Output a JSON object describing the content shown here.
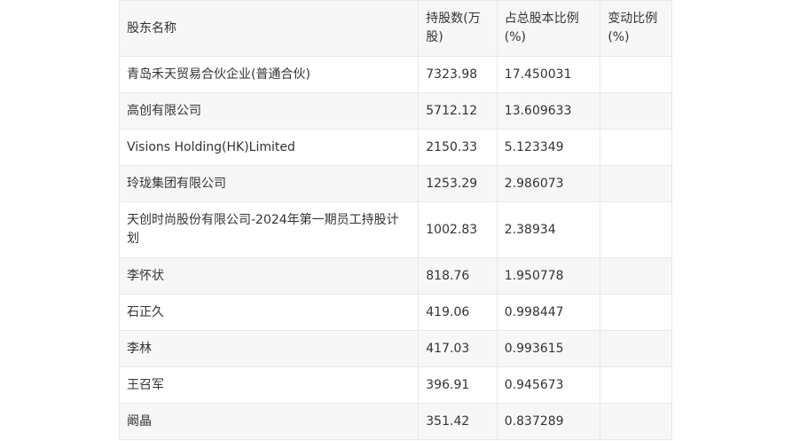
{
  "table": {
    "headers": [
      "股东名称",
      "持股数(万股)",
      "占总股本比例(%)",
      "变动比例(%)"
    ],
    "rows": [
      {
        "name": "青岛禾天贸易合伙企业(普通合伙)",
        "shares": "7323.98",
        "ratio": "17.450031",
        "change": ""
      },
      {
        "name": "高创有限公司",
        "shares": "5712.12",
        "ratio": "13.609633",
        "change": ""
      },
      {
        "name": "Visions Holding(HK)Limited",
        "shares": "2150.33",
        "ratio": "5.123349",
        "change": ""
      },
      {
        "name": "玲珑集团有限公司",
        "shares": "1253.29",
        "ratio": "2.986073",
        "change": ""
      },
      {
        "name": "天创时尚股份有限公司-2024年第一期员工持股计划",
        "shares": "1002.83",
        "ratio": "2.38934",
        "change": ""
      },
      {
        "name": "李怀状",
        "shares": "818.76",
        "ratio": "1.950778",
        "change": ""
      },
      {
        "name": "石正久",
        "shares": "419.06",
        "ratio": "0.998447",
        "change": ""
      },
      {
        "name": "李林",
        "shares": "417.03",
        "ratio": "0.993615",
        "change": ""
      },
      {
        "name": "王召军",
        "shares": "396.91",
        "ratio": "0.945673",
        "change": ""
      },
      {
        "name": "阚晶",
        "shares": "351.42",
        "ratio": "0.837289",
        "change": ""
      }
    ]
  }
}
